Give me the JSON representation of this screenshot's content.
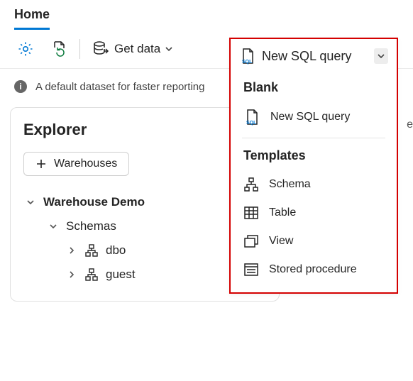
{
  "tab": {
    "home": "Home"
  },
  "toolbar": {
    "get_data": "Get data",
    "new_sql_query": "New SQL query"
  },
  "banner": {
    "text": "A default dataset for faster reporting",
    "cutoff": "e"
  },
  "explorer": {
    "title": "Explorer",
    "warehouses_btn": "Warehouses",
    "tree": {
      "root": "Warehouse Demo",
      "schemas": "Schemas",
      "dbo": "dbo",
      "guest": "guest"
    }
  },
  "dropdown": {
    "section_blank": "Blank",
    "item_new_sql": "New SQL query",
    "section_templates": "Templates",
    "item_schema": "Schema",
    "item_table": "Table",
    "item_view": "View",
    "item_sproc": "Stored procedure"
  }
}
